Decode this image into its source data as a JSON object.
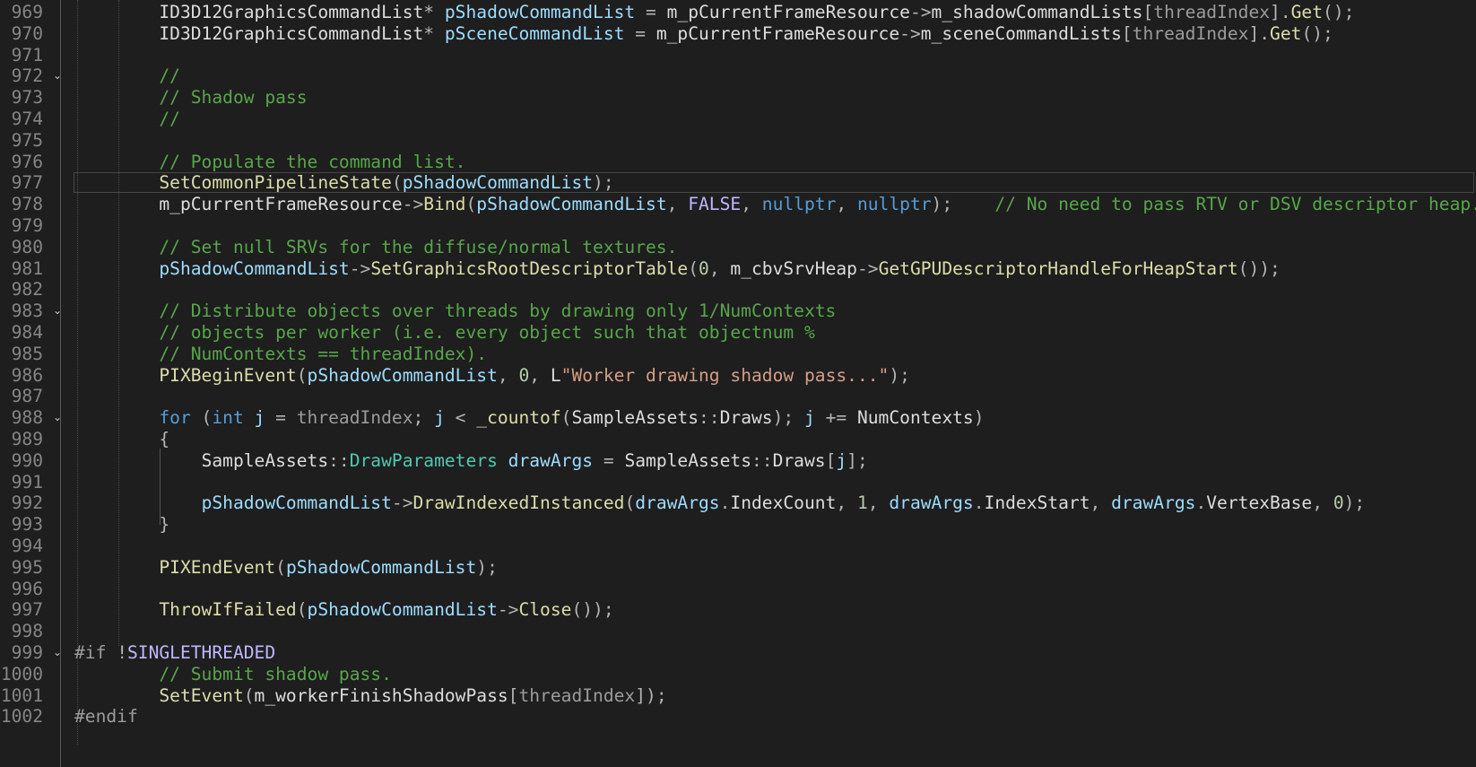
{
  "editor": {
    "colors": {
      "background": "#1e1e1e",
      "line_number": "#858585",
      "plain": "#dcdcdc",
      "keyword": "#569cd6",
      "comment": "#57a64a",
      "function": "#dcdcaa",
      "variable": "#9cdcfe",
      "type": "#4ec9b0",
      "string": "#d69d85",
      "number": "#b5cea8",
      "macro": "#beb7ff",
      "preprocessor": "#9b9b9b"
    },
    "current_line_number": "977",
    "lines": [
      {
        "n": "969",
        "fold": "",
        "tokens": [
          [
            "pl",
            "        "
          ],
          [
            "pl",
            "ID3D12GraphicsCommandList"
          ],
          [
            "op",
            "* "
          ],
          [
            "var",
            "pShadowCommandList"
          ],
          [
            "op",
            " = "
          ],
          [
            "pl",
            "m_pCurrentFrameResource"
          ],
          [
            "op",
            "->"
          ],
          [
            "pl",
            "m_shadowCommandLists"
          ],
          [
            "op",
            "["
          ],
          [
            "inact",
            "threadIndex"
          ],
          [
            "op",
            "]."
          ],
          [
            "fn",
            "Get"
          ],
          [
            "op",
            "();"
          ]
        ]
      },
      {
        "n": "970",
        "fold": "",
        "tokens": [
          [
            "pl",
            "        "
          ],
          [
            "pl",
            "ID3D12GraphicsCommandList"
          ],
          [
            "op",
            "* "
          ],
          [
            "var",
            "pSceneCommandList"
          ],
          [
            "op",
            " = "
          ],
          [
            "pl",
            "m_pCurrentFrameResource"
          ],
          [
            "op",
            "->"
          ],
          [
            "pl",
            "m_sceneCommandLists"
          ],
          [
            "op",
            "["
          ],
          [
            "inact",
            "threadIndex"
          ],
          [
            "op",
            "]."
          ],
          [
            "fn",
            "Get"
          ],
          [
            "op",
            "();"
          ]
        ]
      },
      {
        "n": "971",
        "fold": "",
        "tokens": []
      },
      {
        "n": "972",
        "fold": "⌄",
        "tokens": [
          [
            "pl",
            "        "
          ],
          [
            "cm",
            "//"
          ]
        ]
      },
      {
        "n": "973",
        "fold": "",
        "tokens": [
          [
            "pl",
            "        "
          ],
          [
            "cm",
            "// Shadow pass"
          ]
        ]
      },
      {
        "n": "974",
        "fold": "",
        "tokens": [
          [
            "pl",
            "        "
          ],
          [
            "cm",
            "//"
          ]
        ]
      },
      {
        "n": "975",
        "fold": "",
        "tokens": []
      },
      {
        "n": "976",
        "fold": "",
        "tokens": [
          [
            "pl",
            "        "
          ],
          [
            "cm",
            "// Populate the command list."
          ]
        ]
      },
      {
        "n": "977",
        "fold": "",
        "tokens": [
          [
            "pl",
            "        "
          ],
          [
            "fn",
            "SetCommonPipelineState"
          ],
          [
            "op",
            "("
          ],
          [
            "var",
            "pShadowCommandList"
          ],
          [
            "op",
            ");"
          ]
        ]
      },
      {
        "n": "978",
        "fold": "",
        "tokens": [
          [
            "pl",
            "        "
          ],
          [
            "pl",
            "m_pCurrentFrameResource"
          ],
          [
            "op",
            "->"
          ],
          [
            "fn",
            "Bind"
          ],
          [
            "op",
            "("
          ],
          [
            "var",
            "pShadowCommandList"
          ],
          [
            "op",
            ", "
          ],
          [
            "mac",
            "FALSE"
          ],
          [
            "op",
            ", "
          ],
          [
            "kw",
            "nullptr"
          ],
          [
            "op",
            ", "
          ],
          [
            "kw",
            "nullptr"
          ],
          [
            "op",
            ");"
          ],
          [
            "pl",
            "    "
          ],
          [
            "cm",
            "// No need to pass RTV or DSV descriptor heap."
          ]
        ]
      },
      {
        "n": "979",
        "fold": "",
        "tokens": []
      },
      {
        "n": "980",
        "fold": "",
        "tokens": [
          [
            "pl",
            "        "
          ],
          [
            "cm",
            "// Set null SRVs for the diffuse/normal textures."
          ]
        ]
      },
      {
        "n": "981",
        "fold": "",
        "tokens": [
          [
            "pl",
            "        "
          ],
          [
            "var",
            "pShadowCommandList"
          ],
          [
            "op",
            "->"
          ],
          [
            "fn",
            "SetGraphicsRootDescriptorTable"
          ],
          [
            "op",
            "("
          ],
          [
            "num",
            "0"
          ],
          [
            "op",
            ", "
          ],
          [
            "pl",
            "m_cbvSrvHeap"
          ],
          [
            "op",
            "->"
          ],
          [
            "fn",
            "GetGPUDescriptorHandleForHeapStart"
          ],
          [
            "op",
            "());"
          ]
        ]
      },
      {
        "n": "982",
        "fold": "",
        "tokens": []
      },
      {
        "n": "983",
        "fold": "⌄",
        "tokens": [
          [
            "pl",
            "        "
          ],
          [
            "cm",
            "// Distribute objects over threads by drawing only 1/NumContexts"
          ]
        ]
      },
      {
        "n": "984",
        "fold": "",
        "tokens": [
          [
            "pl",
            "        "
          ],
          [
            "cm",
            "// objects per worker (i.e. every object such that objectnum %"
          ]
        ]
      },
      {
        "n": "985",
        "fold": "",
        "tokens": [
          [
            "pl",
            "        "
          ],
          [
            "cm",
            "// NumContexts == threadIndex)."
          ]
        ]
      },
      {
        "n": "986",
        "fold": "",
        "tokens": [
          [
            "pl",
            "        "
          ],
          [
            "fn",
            "PIXBeginEvent"
          ],
          [
            "op",
            "("
          ],
          [
            "var",
            "pShadowCommandList"
          ],
          [
            "op",
            ", "
          ],
          [
            "num",
            "0"
          ],
          [
            "op",
            ", "
          ],
          [
            "pl",
            "L"
          ],
          [
            "str",
            "\"Worker drawing shadow pass...\""
          ],
          [
            "op",
            ");"
          ]
        ]
      },
      {
        "n": "987",
        "fold": "",
        "tokens": []
      },
      {
        "n": "988",
        "fold": "⌄",
        "tokens": [
          [
            "pl",
            "        "
          ],
          [
            "kw",
            "for"
          ],
          [
            "op",
            " ("
          ],
          [
            "kw",
            "int"
          ],
          [
            "pl",
            " "
          ],
          [
            "var",
            "j"
          ],
          [
            "op",
            " = "
          ],
          [
            "inact",
            "threadIndex"
          ],
          [
            "op",
            "; "
          ],
          [
            "var",
            "j"
          ],
          [
            "op",
            " < "
          ],
          [
            "fn",
            "_countof"
          ],
          [
            "op",
            "("
          ],
          [
            "pl",
            "SampleAssets"
          ],
          [
            "op",
            "::"
          ],
          [
            "pl",
            "Draws"
          ],
          [
            "op",
            "); "
          ],
          [
            "var",
            "j"
          ],
          [
            "op",
            " += "
          ],
          [
            "pl",
            "NumContexts"
          ],
          [
            "op",
            ")"
          ]
        ]
      },
      {
        "n": "989",
        "fold": "",
        "tokens": [
          [
            "pl",
            "        "
          ],
          [
            "op",
            "{"
          ]
        ]
      },
      {
        "n": "990",
        "fold": "",
        "tokens": [
          [
            "pl",
            "            "
          ],
          [
            "pl",
            "SampleAssets"
          ],
          [
            "op",
            "::"
          ],
          [
            "ty",
            "DrawParameters"
          ],
          [
            "pl",
            " "
          ],
          [
            "var",
            "drawArgs"
          ],
          [
            "op",
            " = "
          ],
          [
            "pl",
            "SampleAssets"
          ],
          [
            "op",
            "::"
          ],
          [
            "pl",
            "Draws"
          ],
          [
            "op",
            "["
          ],
          [
            "var",
            "j"
          ],
          [
            "op",
            "];"
          ]
        ]
      },
      {
        "n": "991",
        "fold": "",
        "tokens": []
      },
      {
        "n": "992",
        "fold": "",
        "tokens": [
          [
            "pl",
            "            "
          ],
          [
            "var",
            "pShadowCommandList"
          ],
          [
            "op",
            "->"
          ],
          [
            "fn",
            "DrawIndexedInstanced"
          ],
          [
            "op",
            "("
          ],
          [
            "var",
            "drawArgs"
          ],
          [
            "op",
            "."
          ],
          [
            "pl",
            "IndexCount"
          ],
          [
            "op",
            ", "
          ],
          [
            "num",
            "1"
          ],
          [
            "op",
            ", "
          ],
          [
            "var",
            "drawArgs"
          ],
          [
            "op",
            "."
          ],
          [
            "pl",
            "IndexStart"
          ],
          [
            "op",
            ", "
          ],
          [
            "var",
            "drawArgs"
          ],
          [
            "op",
            "."
          ],
          [
            "pl",
            "VertexBase"
          ],
          [
            "op",
            ", "
          ],
          [
            "num",
            "0"
          ],
          [
            "op",
            ");"
          ]
        ]
      },
      {
        "n": "993",
        "fold": "",
        "tokens": [
          [
            "pl",
            "        "
          ],
          [
            "op",
            "}"
          ]
        ]
      },
      {
        "n": "994",
        "fold": "",
        "tokens": []
      },
      {
        "n": "995",
        "fold": "",
        "tokens": [
          [
            "pl",
            "        "
          ],
          [
            "fn",
            "PIXEndEvent"
          ],
          [
            "op",
            "("
          ],
          [
            "var",
            "pShadowCommandList"
          ],
          [
            "op",
            ");"
          ]
        ]
      },
      {
        "n": "996",
        "fold": "",
        "tokens": []
      },
      {
        "n": "997",
        "fold": "",
        "tokens": [
          [
            "pl",
            "        "
          ],
          [
            "fn",
            "ThrowIfFailed"
          ],
          [
            "op",
            "("
          ],
          [
            "var",
            "pShadowCommandList"
          ],
          [
            "op",
            "->"
          ],
          [
            "fn",
            "Close"
          ],
          [
            "op",
            "());"
          ]
        ]
      },
      {
        "n": "998",
        "fold": "",
        "tokens": []
      },
      {
        "n": "999",
        "fold": "⌄",
        "tokens": [
          [
            "pp",
            "#if"
          ],
          [
            "pl",
            " "
          ],
          [
            "op",
            "!"
          ],
          [
            "mac",
            "SINGLETHREADED"
          ]
        ]
      },
      {
        "n": "1000",
        "fold": "",
        "tokens": [
          [
            "pl",
            "        "
          ],
          [
            "cm",
            "// Submit shadow pass."
          ]
        ]
      },
      {
        "n": "1001",
        "fold": "",
        "tokens": [
          [
            "pl",
            "        "
          ],
          [
            "fn",
            "SetEvent"
          ],
          [
            "op",
            "("
          ],
          [
            "pl",
            "m_workerFinishShadowPass"
          ],
          [
            "op",
            "["
          ],
          [
            "inact",
            "threadIndex"
          ],
          [
            "op",
            "]);"
          ]
        ]
      },
      {
        "n": "1002",
        "fold": "",
        "tokens": [
          [
            "pp",
            "#endif"
          ]
        ]
      }
    ]
  }
}
